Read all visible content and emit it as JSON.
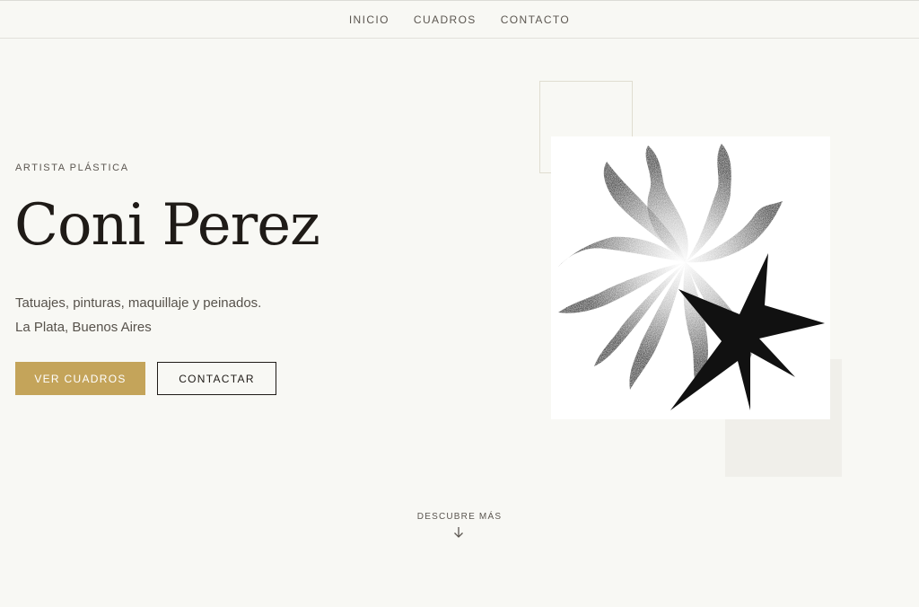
{
  "nav": {
    "items": [
      {
        "label": "INICIO"
      },
      {
        "label": "CUADROS"
      },
      {
        "label": "CONTACTO"
      }
    ]
  },
  "hero": {
    "eyebrow": "ARTISTA PLÁSTICA",
    "title": "Coni Perez",
    "description": "Tatuajes, pinturas, maquillaje y peinados.",
    "location": "La Plata, Buenos Aires",
    "primary_button": "VER CUADROS",
    "secondary_button": "CONTACTAR"
  },
  "artwork": {
    "icon": "sun-and-star-illustration"
  },
  "scroll_hint": {
    "label": "DESCUBRE MÁS",
    "icon": "arrow-down-icon"
  },
  "colors": {
    "background": "#f8f8f4",
    "accent": "#c4a45a",
    "text_dark": "#1f1b17"
  }
}
